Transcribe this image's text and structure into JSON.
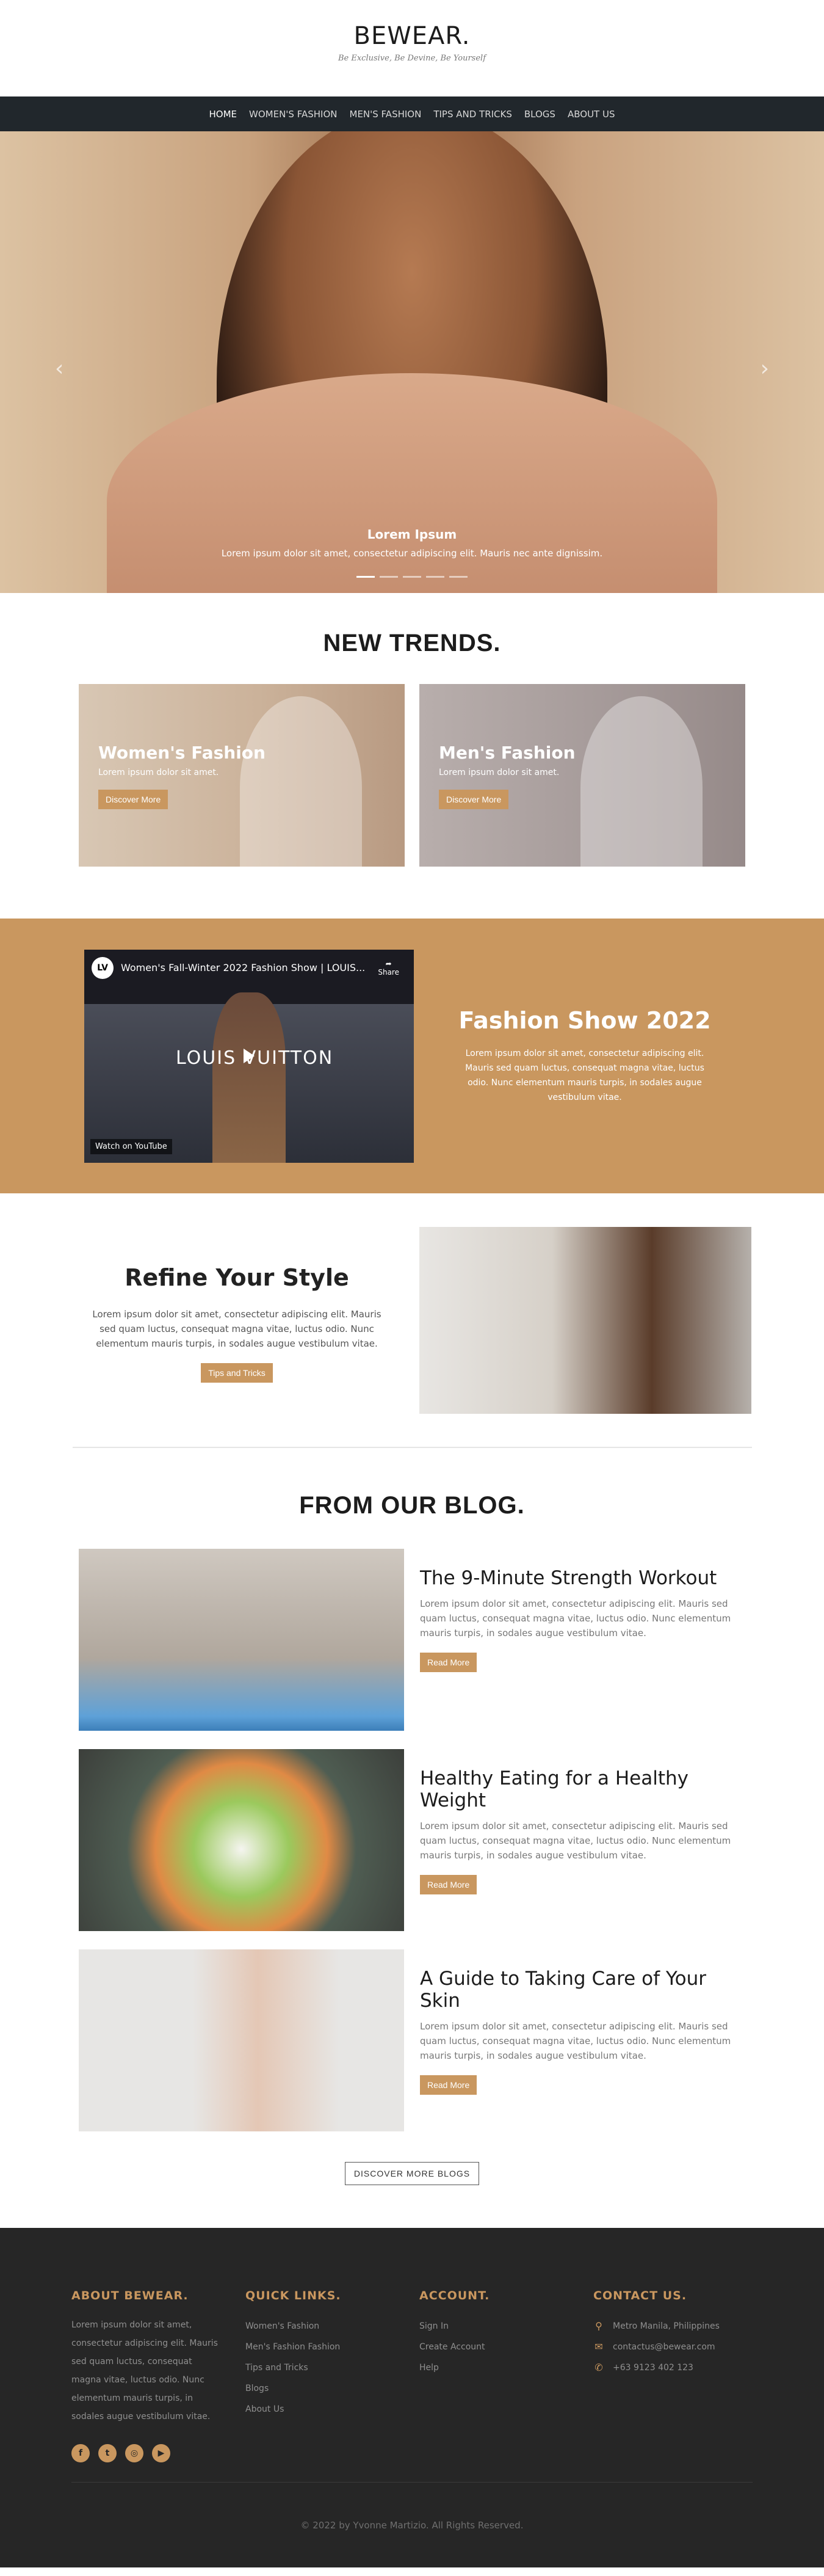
{
  "header": {
    "brand": "BEWEAR.",
    "tagline": "Be Exclusive, Be Devine, Be Yourself"
  },
  "nav": {
    "items": [
      "HOME",
      "WOMEN'S FASHION",
      "MEN'S FASHION",
      "TIPS AND TRICKS",
      "BLOGS",
      "ABOUT US"
    ]
  },
  "hero": {
    "title": "Lorem Ipsum",
    "text": "Lorem ipsum dolor sit amet, consectetur adipiscing elit. Mauris nec ante dignissim.",
    "prev": "‹",
    "next": "›"
  },
  "trends": {
    "title": "NEW TRENDS.",
    "cards": [
      {
        "title": "Women's Fashion",
        "text": "Lorem ipsum dolor sit amet.",
        "button": "Discover More"
      },
      {
        "title": "Men's Fashion",
        "text": "Lorem ipsum dolor sit amet.",
        "button": "Discover More"
      }
    ]
  },
  "fashion": {
    "video_title": "Women's Fall-Winter 2022 Fashion Show | LOUIS...",
    "channel_logo": "LV",
    "share": "Share",
    "brand_text": "LOUIS VUITTON",
    "watch": "Watch on YouTube",
    "title": "Fashion Show 2022",
    "text": "Lorem ipsum dolor sit amet, consectetur adipiscing elit. Mauris sed quam luctus, consequat magna vitae, luctus odio. Nunc elementum mauris turpis, in sodales augue vestibulum vitae."
  },
  "refine": {
    "title": "Refine Your Style",
    "text": "Lorem ipsum dolor sit amet, consectetur adipiscing elit. Mauris sed quam luctus, consequat magna vitae, luctus odio. Nunc elementum mauris turpis, in sodales augue vestibulum vitae.",
    "button": "Tips and Tricks"
  },
  "blog": {
    "title": "FROM OUR BLOG.",
    "posts": [
      {
        "title": "The 9-Minute Strength Workout",
        "text": "Lorem ipsum dolor sit amet, consectetur adipiscing elit. Mauris sed quam luctus, consequat magna vitae, luctus odio. Nunc elementum mauris turpis, in sodales augue vestibulum vitae.",
        "button": "Read More"
      },
      {
        "title": "Healthy Eating for a Healthy Weight",
        "text": "Lorem ipsum dolor sit amet, consectetur adipiscing elit. Mauris sed quam luctus, consequat magna vitae, luctus odio. Nunc elementum mauris turpis, in sodales augue vestibulum vitae.",
        "button": "Read More"
      },
      {
        "title": "A Guide to Taking Care of Your Skin",
        "text": "Lorem ipsum dolor sit amet, consectetur adipiscing elit. Mauris sed quam luctus, consequat magna vitae, luctus odio. Nunc elementum mauris turpis, in sodales augue vestibulum vitae.",
        "button": "Read More"
      }
    ],
    "more_button": "DISCOVER MORE BLOGS"
  },
  "footer": {
    "about_title": "ABOUT BEWEAR.",
    "about_text": "Lorem ipsum dolor sit amet, consectetur adipiscing elit. Mauris sed quam luctus, consequat magna vitae, luctus odio. Nunc elementum mauris turpis, in sodales augue vestibulum vitae.",
    "socials": [
      "f",
      "t",
      "◎",
      "▶"
    ],
    "quick_title": "QUICK LINKS.",
    "quick_links": [
      "Women's Fashion",
      "Men's Fashion Fashion",
      "Tips and Tricks",
      "Blogs",
      "About Us"
    ],
    "account_title": "ACCOUNT.",
    "account_links": [
      "Sign In",
      "Create Account",
      "Help"
    ],
    "contact_title": "CONTACT US.",
    "contact": [
      {
        "icon": "map-pin-icon",
        "glyph": "⚲",
        "text": "Metro Manila, Philippines"
      },
      {
        "icon": "mail-icon",
        "glyph": "✉",
        "text": "contactus@bewear.com"
      },
      {
        "icon": "phone-icon",
        "glyph": "✆",
        "text": "+63 9123 402 123"
      }
    ],
    "copyright": "© 2022 by Yvonne Martizio. All Rights Reserved."
  },
  "colors": {
    "accent": "#c9975f",
    "nav_bg": "#21272c",
    "footer_bg": "#262626"
  }
}
